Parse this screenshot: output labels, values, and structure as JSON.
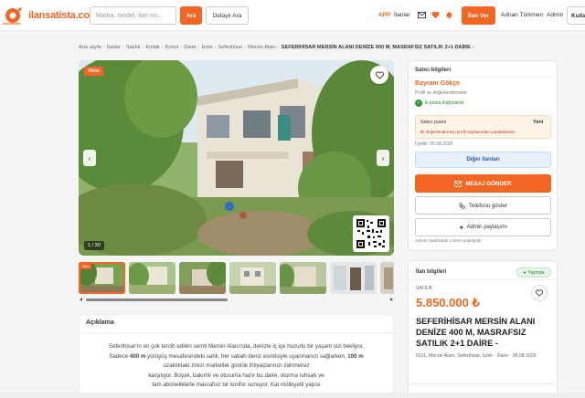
{
  "header": {
    "logo_text": "ilansatista.com",
    "logo_sub": "ilansatista",
    "search_placeholder": "Marka, model, ilan no...",
    "search_button": "Ara",
    "detail_search": "Detaylı Ara",
    "app_link": "APP",
    "listings_link": "İlanlar",
    "post_button": "İlan Ver",
    "user_name": "Adnan Türkmen",
    "admin_link": "Admin",
    "user_menu": "Kulla"
  },
  "breadcrumb": [
    "Ana sayfa",
    "İlanlar",
    "Satılık",
    "Emlak",
    "Konut",
    "Daire",
    "İzmir",
    "Seferihisar",
    "Mersin Alanı"
  ],
  "breadcrumb_last": "SEFERİHİSAR MERSİN ALANI DENİZE 400 M, MASRAFSIZ SATILIK 2+1 DAİRE -",
  "gallery": {
    "badge": "Vitrin",
    "counter": "1 / 30",
    "thumb_badge": "Vitrin"
  },
  "description": {
    "title": "Açıklama",
    "lines": [
      "Seferihisar'ın en çok tercih edilen semti Mersin Alanı'nda, denizle iç içe huzurlu bir yaşam sizi bekliyor.",
      "Sadece |400 m| yürüyüş mesafesindeki sahil, her sabah deniz esintisiyle uyanmanızı sağlarken, |100 m|",
      "uzaklıktaki zincir marketler günlük ihtiyaçlarınızı zahmetsiz",
      "karşılıyor. Boyalı, bakımlı ve oturuma hazır bu daire, oturma ruhsatı ve",
      "tam aboneliklerle masrafsız bir konfor sunuyor. Kat mülkiyetli yapısı"
    ]
  },
  "seller": {
    "title": "Satıcı bilgileri",
    "name": "Bayram Gökçe",
    "role": "Profil ve değerlendirmeler",
    "verified": "E-posta doğrulandı",
    "rating_label": "Satıcı puanı",
    "rating_value": "Yeni",
    "rating_note": "İlk değerlendirmeyi profil sayfasından yapabilirsiniz.",
    "since": "Üyelik: 05.08.2026",
    "other_listings": "Diğer ilanları",
    "message_button": "MESAJ GÖNDER",
    "phone_button": "Telefonu göster",
    "admin_share_button": "Admin paylaşımı",
    "shared_note": "Admin tarafından 1 kere paylaşıldı"
  },
  "listing": {
    "title": "İlan bilgileri",
    "status": "Yayında",
    "type": "SATILIK",
    "price": "5.850.000 ₺",
    "headline": "SEFERİHİSAR MERSİN ALANI DENİZE 400 M, MASRAFSIZ SATILIK 2+1 DAİRE -",
    "location": "6011, Mersin Alanı, Seferihisar, İzmir · Daire · 05.08.2026"
  },
  "colors": {
    "accent": "#f26522",
    "success": "#2e7d32",
    "info": "#2a5ca8"
  }
}
